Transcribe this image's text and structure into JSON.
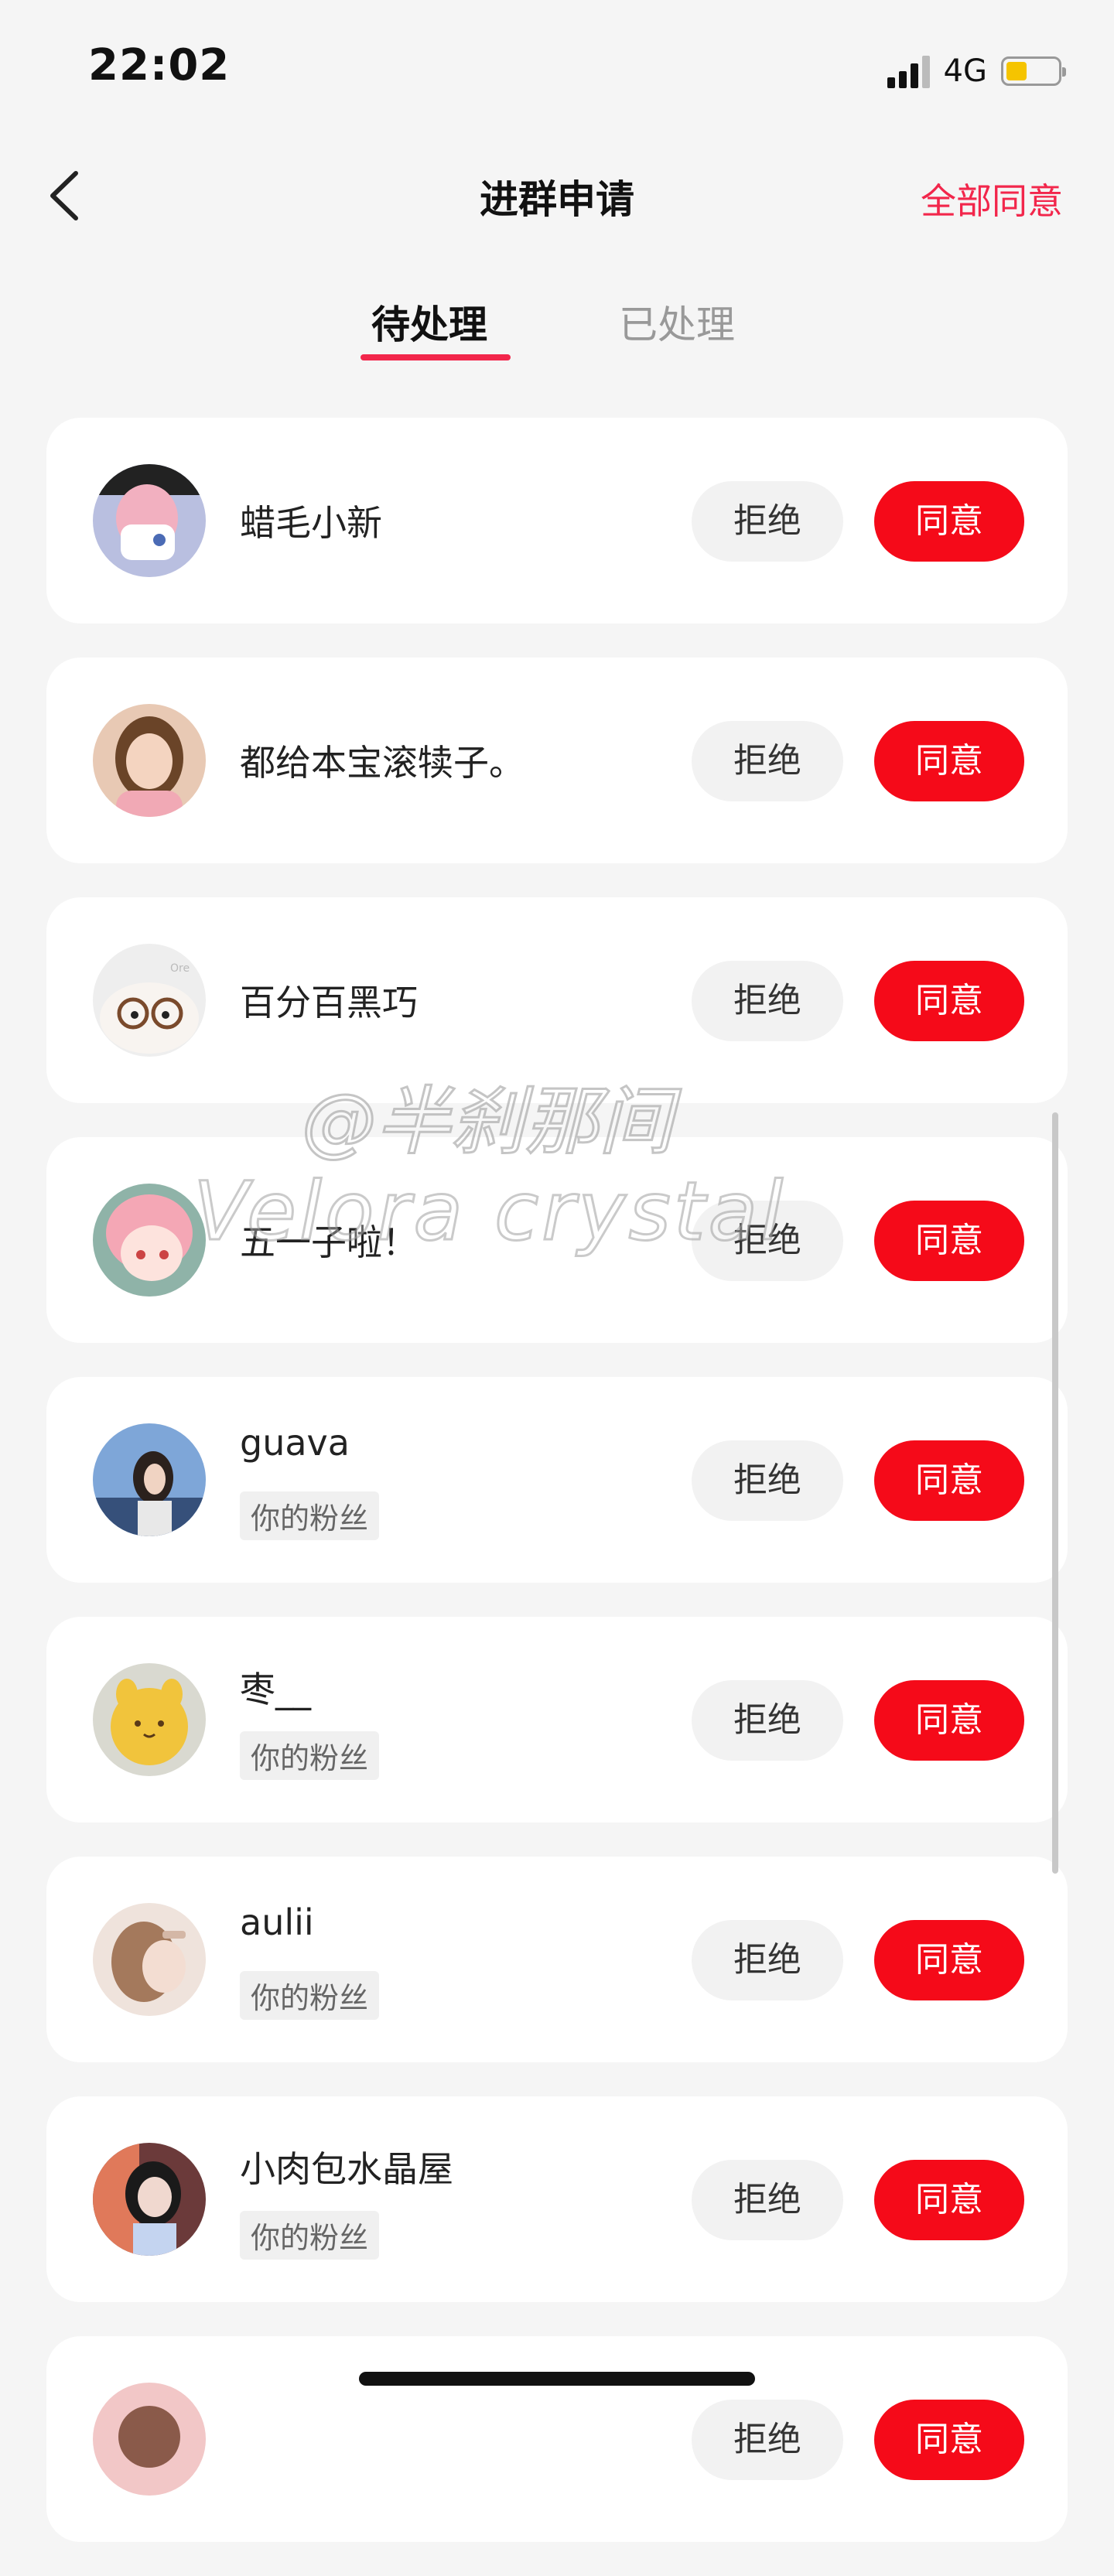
{
  "status_bar": {
    "time": "22:02",
    "network": "4G",
    "signal_bars": 3,
    "battery_level": 0.4
  },
  "header": {
    "title": "进群申请",
    "agree_all": "全部同意"
  },
  "tabs": [
    {
      "label": "待处理",
      "active": true
    },
    {
      "label": "已处理",
      "active": false
    }
  ],
  "buttons": {
    "reject": "拒绝",
    "agree": "同意"
  },
  "requests": [
    {
      "name": "蜡毛小新",
      "tag": null,
      "avatar": "cartoon-avatar"
    },
    {
      "name": "都给本宝滚犊子。",
      "tag": null,
      "avatar": "girl-photo-avatar"
    },
    {
      "name": "百分百黑巧",
      "tag": null,
      "avatar": "bear-toy-avatar"
    },
    {
      "name": "五一子啦！",
      "tag": null,
      "avatar": "anime-avatar"
    },
    {
      "name": "guava",
      "tag": "你的粉丝",
      "avatar": "photo-avatar"
    },
    {
      "name": "枣__",
      "tag": "你的粉丝",
      "avatar": "cookie-avatar"
    },
    {
      "name": "aulii",
      "tag": "你的粉丝",
      "avatar": "photo-avatar"
    },
    {
      "name": "小肉包水晶屋",
      "tag": "你的粉丝",
      "avatar": "photo-avatar"
    },
    {
      "name": "",
      "tag": null,
      "avatar": "photo-avatar"
    }
  ],
  "watermark": {
    "line1": "@半刹那间",
    "line2": "Velora crystal"
  },
  "colors": {
    "accent": "#f2264b",
    "agree_button": "#f50a19",
    "background": "#f5f5f5"
  }
}
